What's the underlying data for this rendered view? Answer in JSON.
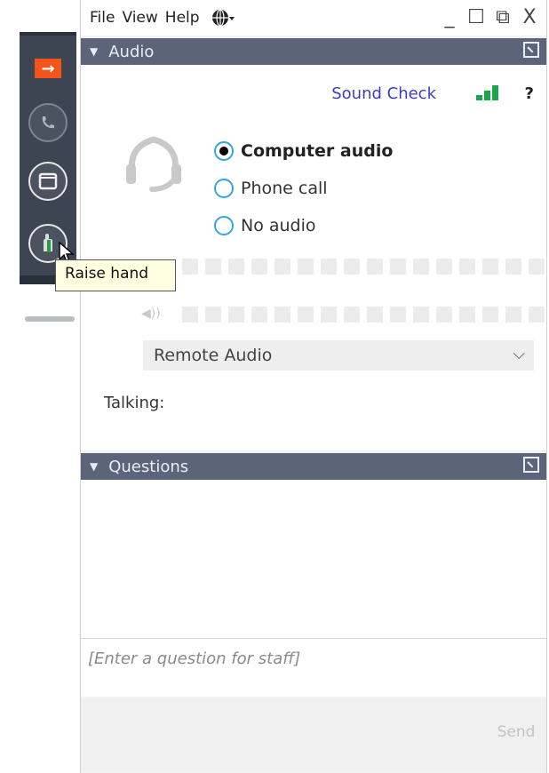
{
  "menu": {
    "file": "File",
    "view": "View",
    "help": "Help"
  },
  "window_controls": {
    "minimize": "_",
    "maximize": "☐",
    "restore": "⧉",
    "close": "X"
  },
  "audio_panel": {
    "header": "Audio",
    "sound_check": "Sound Check",
    "help_symbol": "?",
    "options": [
      {
        "label": "Computer audio",
        "selected": true
      },
      {
        "label": "Phone call",
        "selected": false
      },
      {
        "label": "No audio",
        "selected": false
      }
    ],
    "speaker_device": "Remote Audio",
    "talking_label": "Talking:"
  },
  "questions_panel": {
    "header": "Questions",
    "input_placeholder": "[Enter a question for staff]",
    "send_label": "Send"
  },
  "tooltip": {
    "text": "Raise hand"
  },
  "colors": {
    "panel_header": "#5b6478",
    "toolbar": "#3d4552",
    "accent_orange": "#f2541b",
    "link_blue": "#3c3cc8",
    "signal_green": "#1aa54a",
    "radio_blue": "#35a7e0"
  },
  "icons": {
    "toolbar": [
      "arrow-right-icon",
      "phone-icon",
      "window-icon",
      "raise-hand-icon"
    ],
    "panel": [
      "collapse-triangle-icon",
      "popout-icon",
      "headset-icon",
      "speaker-icon",
      "signal-strength-icon",
      "globe-icon"
    ]
  }
}
